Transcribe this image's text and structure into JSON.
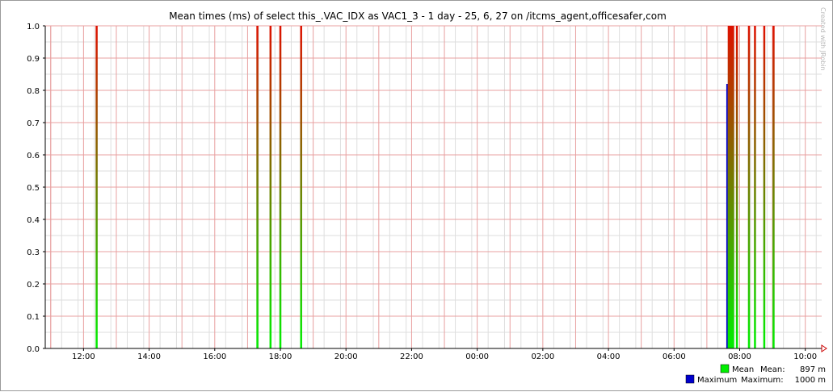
{
  "chart_data": {
    "type": "bar",
    "title": "Mean times (ms) of select this_.VAC_IDX as VAC1_3 - 1 day - 25, 6, 27 on /itcms_agent,officesafer,com",
    "xlabel": "",
    "ylabel": "",
    "xlim": [
      "10:50",
      "10:30"
    ],
    "ylim": [
      0,
      1.0
    ],
    "y_ticks": [
      "0.0",
      "0.1",
      "0.2",
      "0.3",
      "0.4",
      "0.5",
      "0.6",
      "0.7",
      "0.8",
      "0.9",
      "1.0"
    ],
    "x_ticks": [
      "12:00",
      "14:00",
      "16:00",
      "18:00",
      "20:00",
      "22:00",
      "00:00",
      "02:00",
      "04:00",
      "06:00",
      "08:00",
      "10:00"
    ],
    "grid": true,
    "legend_position": "bottom-right",
    "series": [
      {
        "name": "Mean",
        "color": "#00ee00",
        "color_top": "#dd1100",
        "summary_label": "Mean:",
        "summary_value": "897 m",
        "points": [
          {
            "t": "12:24",
            "v": 1.0
          },
          {
            "t": "17:18",
            "v": 1.0
          },
          {
            "t": "17:42",
            "v": 1.0
          },
          {
            "t": "18:00",
            "v": 1.0
          },
          {
            "t": "18:38",
            "v": 1.0
          },
          {
            "t": "07:40",
            "v": 1.0
          },
          {
            "t": "07:42",
            "v": 1.0
          },
          {
            "t": "07:44",
            "v": 1.0
          },
          {
            "t": "07:46",
            "v": 1.0
          },
          {
            "t": "07:48",
            "v": 1.0
          },
          {
            "t": "07:55",
            "v": 1.0
          },
          {
            "t": "08:17",
            "v": 1.0
          },
          {
            "t": "08:28",
            "v": 1.0
          },
          {
            "t": "08:45",
            "v": 1.0
          },
          {
            "t": "09:02",
            "v": 1.0
          }
        ]
      },
      {
        "name": "Maximum",
        "color": "#0000cc",
        "summary_label": "Maximum:",
        "summary_value": "1000 m",
        "points": [
          {
            "t": "07:37",
            "v": 0.82
          }
        ]
      }
    ]
  },
  "watermark": "Created with JRobin"
}
